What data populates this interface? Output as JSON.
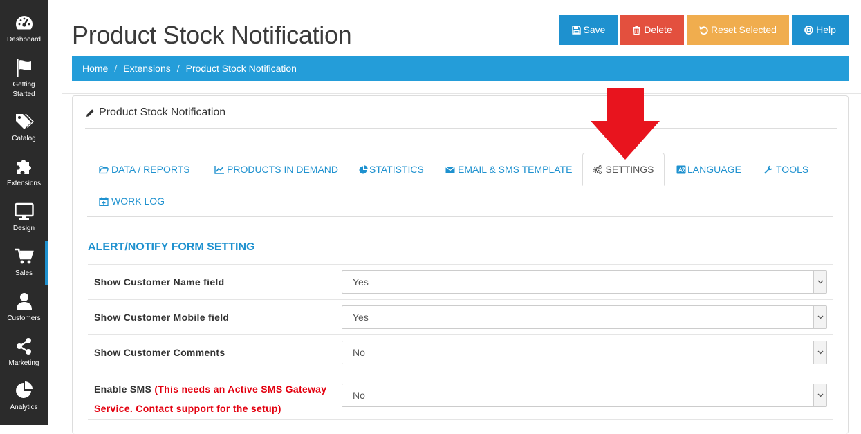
{
  "sidebar": {
    "items": [
      {
        "label": "Dashboard",
        "icon": "dashboard-icon"
      },
      {
        "label": "Getting\nStarted",
        "icon": "flag-icon"
      },
      {
        "label": "Catalog",
        "icon": "tags-icon"
      },
      {
        "label": "Extensions",
        "icon": "puzzle-icon"
      },
      {
        "label": "Design",
        "icon": "monitor-icon"
      },
      {
        "label": "Sales",
        "icon": "cart-icon"
      },
      {
        "label": "Customers",
        "icon": "user-icon"
      },
      {
        "label": "Marketing",
        "icon": "share-icon"
      },
      {
        "label": "Analytics",
        "icon": "pie-chart-icon"
      }
    ]
  },
  "header": {
    "title": "Product Stock Notification",
    "buttons": {
      "save": "Save",
      "delete": "Delete",
      "reset": "Reset Selected",
      "help": "Help"
    }
  },
  "breadcrumb": [
    "Home",
    "Extensions",
    "Product Stock Notification"
  ],
  "panel": {
    "heading": "Product Stock Notification",
    "tabs": [
      {
        "label": "DATA / REPORTS",
        "icon": "folder-open-icon"
      },
      {
        "label": "PRODUCTS IN DEMAND",
        "icon": "line-chart-icon"
      },
      {
        "label": "STATISTICS",
        "icon": "pie-chart-icon"
      },
      {
        "label": "EMAIL & SMS TEMPLATE",
        "icon": "envelope-icon"
      },
      {
        "label": "SETTINGS",
        "icon": "cogs-icon",
        "active": true
      },
      {
        "label": "LANGUAGE",
        "icon": "language-icon"
      },
      {
        "label": "TOOLS",
        "icon": "wrench-icon"
      },
      {
        "label": "WORK LOG",
        "icon": "calendar-plus-icon"
      }
    ],
    "section_title": "ALERT/NOTIFY FORM SETTING",
    "rows": [
      {
        "label": "Show Customer Name field",
        "value": "Yes"
      },
      {
        "label": "Show Customer Mobile field",
        "value": "Yes"
      },
      {
        "label": "Show Customer Comments",
        "value": "No"
      },
      {
        "label": "Enable SMS",
        "note": "(This needs an Active SMS Gateway",
        "note2": "Service. Contact support for the setup)",
        "value": "No"
      }
    ]
  },
  "colors": {
    "sidebar": "#2b2b2b",
    "primary": "#1e91cf",
    "danger": "#e3503e",
    "warning": "#f0ad4e",
    "annotation_arrow": "#e8141e"
  }
}
